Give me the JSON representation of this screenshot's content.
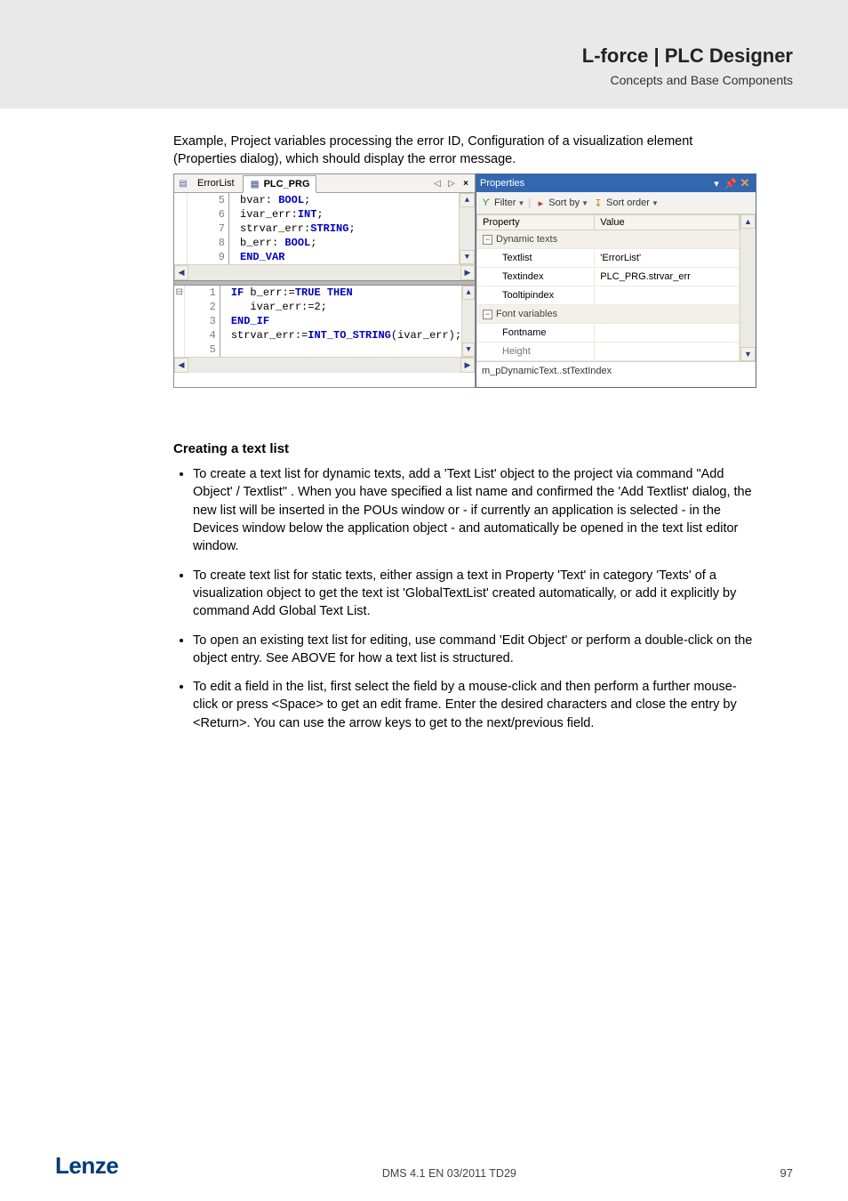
{
  "header": {
    "title": "L-force | PLC Designer",
    "subtitle": "Concepts and Base Components"
  },
  "caption": "Example, Project variables processing the error ID, Configuration of a visualization element (Properties dialog), which should display the error message.",
  "editor": {
    "tabs": {
      "inactive": "ErrorList",
      "active": "PLC_PRG"
    },
    "decl": {
      "lines": [
        "5",
        "6",
        "7",
        "8",
        "9"
      ],
      "code": [
        {
          "text": "bvar: ",
          "tail_kw": "BOOL",
          "suffix": ";"
        },
        {
          "text": "ivar_err:",
          "tail_kw": "INT",
          "suffix": ";"
        },
        {
          "text": "strvar_err:",
          "tail_kw": "STRING",
          "suffix": ";"
        },
        {
          "text": "b_err: ",
          "tail_kw": "BOOL",
          "suffix": ";"
        },
        {
          "kw": "END_VAR"
        }
      ]
    },
    "impl": {
      "lines": [
        "1",
        "2",
        "3",
        "4",
        "5"
      ],
      "code": [
        "IF b_err:=TRUE THEN",
        "   ivar_err:=2;",
        "END_IF",
        "strvar_err:=INT_TO_STRING(ivar_err);",
        ""
      ]
    }
  },
  "properties": {
    "title": "Properties",
    "toolbar": {
      "filter": "Filter",
      "sortby": "Sort by",
      "sortorder": "Sort order"
    },
    "columns": {
      "prop": "Property",
      "val": "Value"
    },
    "groups": {
      "dynamic": "Dynamic texts",
      "fontvars": "Font variables"
    },
    "rows": {
      "textlist": {
        "label": "Textlist",
        "value": "'ErrorList'"
      },
      "textindex": {
        "label": "Textindex",
        "value": "PLC_PRG.strvar_err"
      },
      "tooltipindex": {
        "label": "Tooltipindex",
        "value": ""
      },
      "fontname": {
        "label": "Fontname",
        "value": ""
      },
      "height": {
        "label": "Height",
        "value": ""
      }
    },
    "path": "m_pDynamicText..stTextIndex"
  },
  "section_title": "Creating a text list",
  "bullets": [
    "To create a text list for dynamic texts, add a 'Text List' object to the project via command \"Add Object' / Textlist\" . When you have specified a list name and confirmed the 'Add Textlist' dialog, the new list will be inserted in the POUs window or - if currently an application is selected - in the Devices window below the application object - and automatically be opened in the text list editor window.",
    "To create text list for static texts, either assign a text in Property 'Text' in category 'Texts' of a visualization object to get the text ist 'GlobalTextList' created automatically, or add it explicitly by command Add Global Text List.",
    "To open an existing text list for editing, use command 'Edit Object' or perform a double-click on the object entry. See ABOVE for how a text list is structured.",
    "To edit a field in the list, first select the field by a mouse-click and then perform a further mouse-click or press <Space> to get an edit frame. Enter the desired characters and close the entry by <Return>. You can use the arrow keys to get to the next/previous field."
  ],
  "footer": {
    "logo": "Lenze",
    "mid": "DMS 4.1 EN 03/2011 TD29",
    "page": "97"
  }
}
